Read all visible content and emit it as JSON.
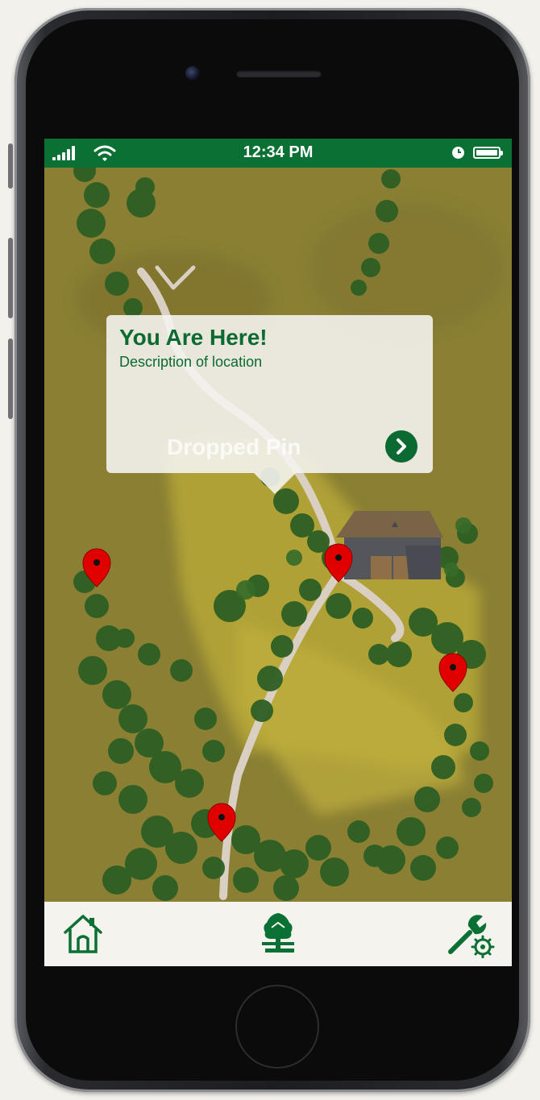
{
  "status_bar": {
    "time": "12:34 PM",
    "icons": [
      "signal-icon",
      "wifi-icon",
      "clock-icon",
      "battery-icon"
    ]
  },
  "callout": {
    "title": "You Are Here!",
    "description": "Description of location",
    "ghost_label": "Dropped Pin",
    "action_icon": "chevron-right-icon"
  },
  "map": {
    "pins": [
      "location-pin-left",
      "location-pin-barn",
      "location-pin-right",
      "location-pin-bottom"
    ],
    "landmarks": [
      "barn"
    ]
  },
  "tab_bar": {
    "items": [
      {
        "name": "home",
        "icon": "home-icon"
      },
      {
        "name": "map",
        "icon": "tree-icon"
      },
      {
        "name": "settings",
        "icon": "wrench-gear-icon"
      }
    ]
  },
  "colors": {
    "brand_green": "#0a7033",
    "map_olive": "#8a7f33",
    "pin_red": "#e00000"
  }
}
